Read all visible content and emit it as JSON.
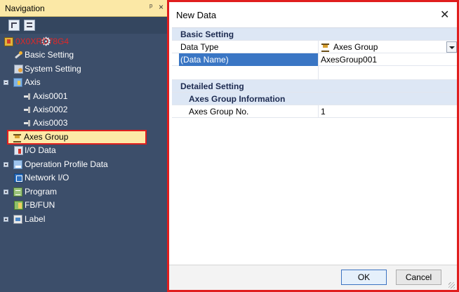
{
  "navigation": {
    "title": "Navigation",
    "pin_glyph": "ᵖ",
    "close_glyph": "×",
    "toolbar": [
      "expand-all-icon",
      "collapse-all-icon",
      "gear-icon"
    ],
    "tree": [
      {
        "label": "0X0XRD78G4",
        "icon": "project-icon",
        "color": "#e02828"
      },
      {
        "label": "Basic Setting",
        "icon": "basic-setting-icon"
      },
      {
        "label": "System Setting",
        "icon": "system-setting-icon"
      },
      {
        "label": "Axis",
        "icon": "axis-icon"
      },
      {
        "label": "Axis0001",
        "icon": "axis-item-icon"
      },
      {
        "label": "Axis0002",
        "icon": "axis-item-icon"
      },
      {
        "label": "Axis0003",
        "icon": "axis-item-icon"
      },
      {
        "label": "Axes Group",
        "icon": "axes-group-icon",
        "selected": true
      },
      {
        "label": "I/O Data",
        "icon": "io-data-icon"
      },
      {
        "label": "Operation Profile Data",
        "icon": "operation-profile-icon"
      },
      {
        "label": "Network I/O",
        "icon": "network-io-icon"
      },
      {
        "label": "Program",
        "icon": "program-icon"
      },
      {
        "label": "FB/FUN",
        "icon": "fb-fun-icon"
      },
      {
        "label": "Label",
        "icon": "label-icon"
      }
    ]
  },
  "dialog": {
    "title": "New Data",
    "close_glyph": "✕",
    "sections": {
      "basic": {
        "header": "Basic Setting",
        "data_type_label": "Data Type",
        "data_type_value": "Axes Group",
        "data_name_label": "(Data Name)",
        "data_name_value": "AxesGroup001"
      },
      "detailed": {
        "header": "Detailed Setting",
        "subheader": "Axes Group Information",
        "group_no_label": "Axes Group No.",
        "group_no_value": "1"
      }
    },
    "ok_label": "OK",
    "cancel_label": "Cancel"
  },
  "colors": {
    "nav_bg": "#3c4e6a",
    "nav_title_bg": "#fbe8a6",
    "highlight_border": "#e01e1e",
    "selection_blue": "#3a76c4",
    "category_bg": "#dde7f5"
  }
}
